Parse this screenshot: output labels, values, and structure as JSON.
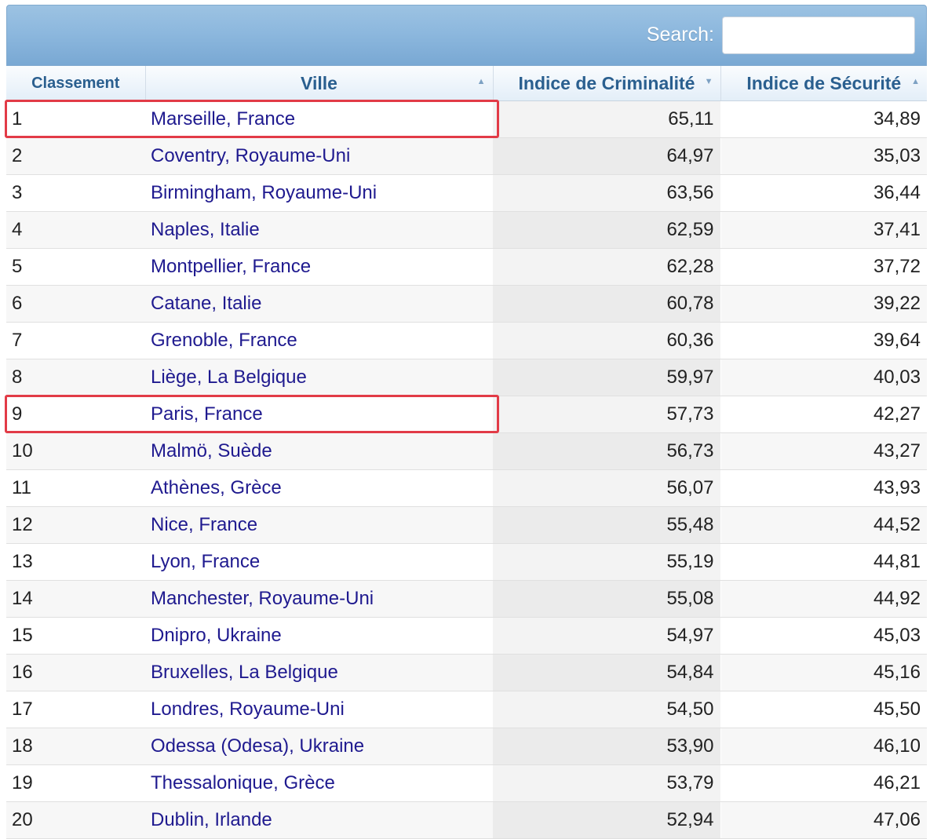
{
  "search": {
    "label": "Search:",
    "value": ""
  },
  "headers": [
    "Classement",
    "Ville",
    "Indice de Criminalité",
    "Indice de Sécurité"
  ],
  "rows": [
    {
      "rank": "1",
      "city": "Marseille, France",
      "crime": "65,11",
      "safety": "34,89"
    },
    {
      "rank": "2",
      "city": "Coventry, Royaume-Uni",
      "crime": "64,97",
      "safety": "35,03"
    },
    {
      "rank": "3",
      "city": "Birmingham, Royaume-Uni",
      "crime": "63,56",
      "safety": "36,44"
    },
    {
      "rank": "4",
      "city": "Naples, Italie",
      "crime": "62,59",
      "safety": "37,41"
    },
    {
      "rank": "5",
      "city": "Montpellier, France",
      "crime": "62,28",
      "safety": "37,72"
    },
    {
      "rank": "6",
      "city": "Catane, Italie",
      "crime": "60,78",
      "safety": "39,22"
    },
    {
      "rank": "7",
      "city": "Grenoble, France",
      "crime": "60,36",
      "safety": "39,64"
    },
    {
      "rank": "8",
      "city": "Liège, La Belgique",
      "crime": "59,97",
      "safety": "40,03"
    },
    {
      "rank": "9",
      "city": "Paris, France",
      "crime": "57,73",
      "safety": "42,27"
    },
    {
      "rank": "10",
      "city": "Malmö, Suède",
      "crime": "56,73",
      "safety": "43,27"
    },
    {
      "rank": "11",
      "city": "Athènes, Grèce",
      "crime": "56,07",
      "safety": "43,93"
    },
    {
      "rank": "12",
      "city": "Nice, France",
      "crime": "55,48",
      "safety": "44,52"
    },
    {
      "rank": "13",
      "city": "Lyon, France",
      "crime": "55,19",
      "safety": "44,81"
    },
    {
      "rank": "14",
      "city": "Manchester, Royaume-Uni",
      "crime": "55,08",
      "safety": "44,92"
    },
    {
      "rank": "15",
      "city": "Dnipro, Ukraine",
      "crime": "54,97",
      "safety": "45,03"
    },
    {
      "rank": "16",
      "city": "Bruxelles, La Belgique",
      "crime": "54,84",
      "safety": "45,16"
    },
    {
      "rank": "17",
      "city": "Londres, Royaume-Uni",
      "crime": "54,50",
      "safety": "45,50"
    },
    {
      "rank": "18",
      "city": "Odessa (Odesa), Ukraine",
      "crime": "53,90",
      "safety": "46,10"
    },
    {
      "rank": "19",
      "city": "Thessalonique, Grèce",
      "crime": "53,79",
      "safety": "46,21"
    },
    {
      "rank": "20",
      "city": "Dublin, Irlande",
      "crime": "52,94",
      "safety": "47,06"
    }
  ],
  "highlighted_ranks": [
    "1",
    "9"
  ],
  "colors": {
    "header_bar": "#8db8de",
    "header_text": "#2a5f8f",
    "link": "#1f1a8f",
    "highlight": "#e23b47"
  },
  "icons": {
    "sort_asc": "sort-ascending-icon",
    "sort_desc": "sort-descending-icon"
  }
}
